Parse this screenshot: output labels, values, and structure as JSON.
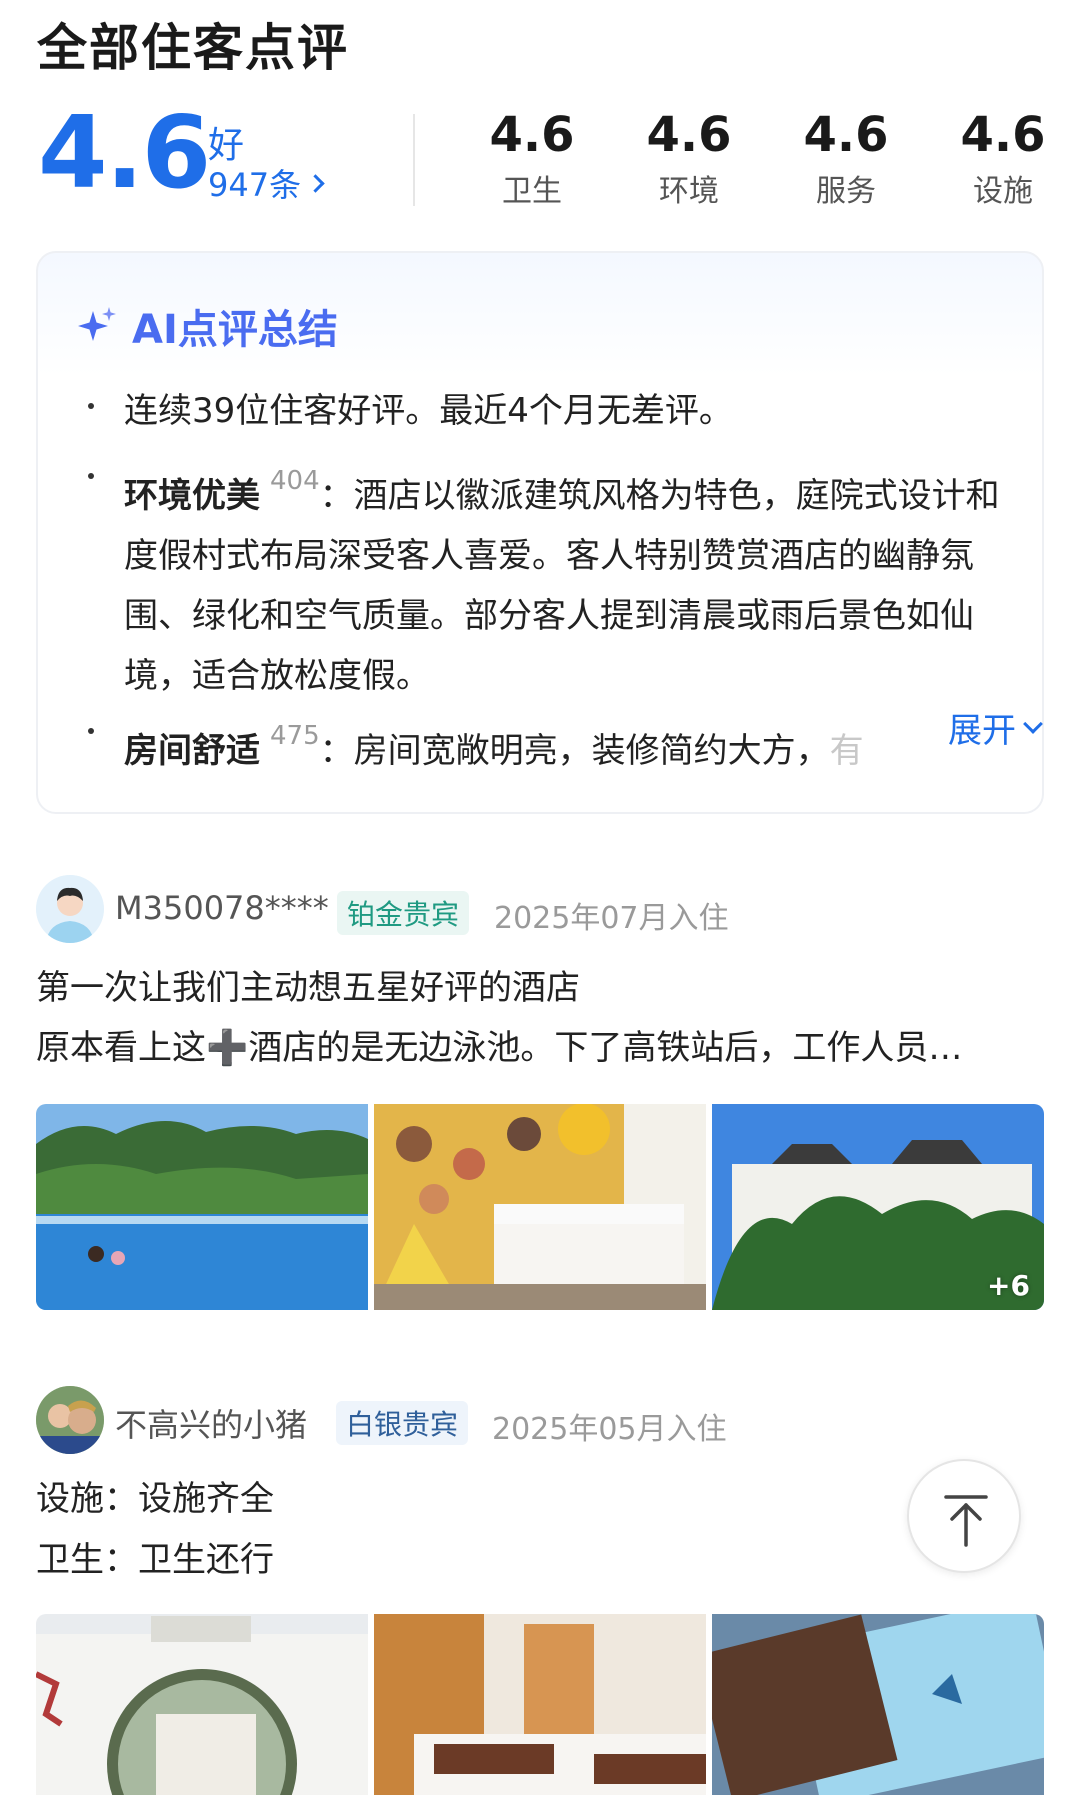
{
  "header": {
    "title": "全部住客点评"
  },
  "score": {
    "overall": "4.6",
    "grade": "好",
    "count": "947条",
    "sub_scores": [
      {
        "value": "4.6",
        "label": "卫生"
      },
      {
        "value": "4.6",
        "label": "环境"
      },
      {
        "value": "4.6",
        "label": "服务"
      },
      {
        "value": "4.6",
        "label": "设施"
      }
    ]
  },
  "ai_summary": {
    "title": "AI点评总结",
    "item1": "连续39位住客好评。最近4个月无差评。",
    "item2_tag": "环境优美",
    "item2_count": "404",
    "item2_text": "：酒店以徽派建筑风格为特色，庭院式设计和度假村式布局深受客人喜爱。客人特别赞赏酒店的幽静氛围、绿化和空气质量。部分客人提到清晨或雨后景色如仙境，适合放松度假。",
    "item3_tag": "房间舒适",
    "item3_count": "475",
    "item3_text": "：房间宽敞明亮，装修简约大方，",
    "item3_fade": "有",
    "expand_label": "展开"
  },
  "reviews": [
    {
      "user": "M350078****",
      "level": "铂金贵宾",
      "stay": "2025年07月入住",
      "line1": "第一次让我们主动想五星好评的酒店",
      "line2": "原本看上这➕酒店的是无边泳池。下了高铁站后，工作人员…",
      "more_photos": "+6"
    },
    {
      "user": "不高兴的小猪",
      "level": "白银贵宾",
      "stay": "2025年05月入住",
      "line1": "设施：设施齐全",
      "line2": "卫生：卫生还行"
    }
  ],
  "colors": {
    "accent": "#1f6ee8",
    "ai_title": "#4a6cf0",
    "badge_platinum": "#1f9a82",
    "badge_silver": "#2f5f9a"
  },
  "icons": {
    "count_link": "chevron-right-icon",
    "ai": "sparkle-icon",
    "expand": "chevron-down-icon",
    "back_to_top": "arrow-up-icon"
  }
}
